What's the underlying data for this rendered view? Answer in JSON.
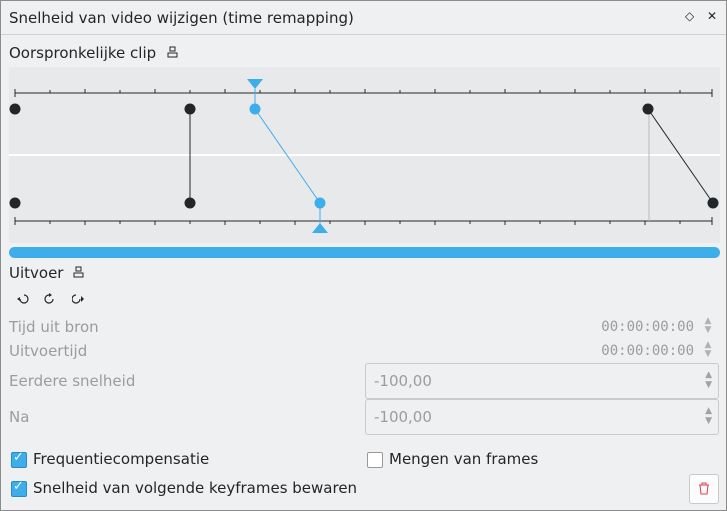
{
  "window": {
    "title": "Snelheid van video wijzigen (time remapping)",
    "float_icon": "◇",
    "close_icon": "✕"
  },
  "original_clip": {
    "label": "Oorspronkelijke clip",
    "icon": "keyframe-icon"
  },
  "output": {
    "label": "Uitvoer",
    "icon": "keyframe-icon"
  },
  "tools": [
    {
      "name": "add-keyframe",
      "glyph": "↶̇"
    },
    {
      "name": "move-keyframe",
      "glyph": "↷"
    },
    {
      "name": "next-keyframe",
      "glyph": "⟳"
    }
  ],
  "source_time": {
    "label": "Tijd uit bron",
    "value": "00:00:00:00"
  },
  "output_time": {
    "label": "Uitvoertijd",
    "value": "00:00:00:00"
  },
  "speed_before": {
    "label": "Eerdere snelheid",
    "value": "-100,00"
  },
  "speed_after": {
    "label": "Na",
    "value": "-100,00"
  },
  "options": {
    "pitch_comp": {
      "label": "Frequentiecompensatie",
      "checked": true
    },
    "frame_blend": {
      "label": "Mengen van frames",
      "checked": false
    },
    "keep_speed": {
      "label": "Snelheid van volgende keyframes bewaren",
      "checked": true
    }
  },
  "colors": {
    "accent": "#3daee9",
    "delete": "#da4453"
  }
}
